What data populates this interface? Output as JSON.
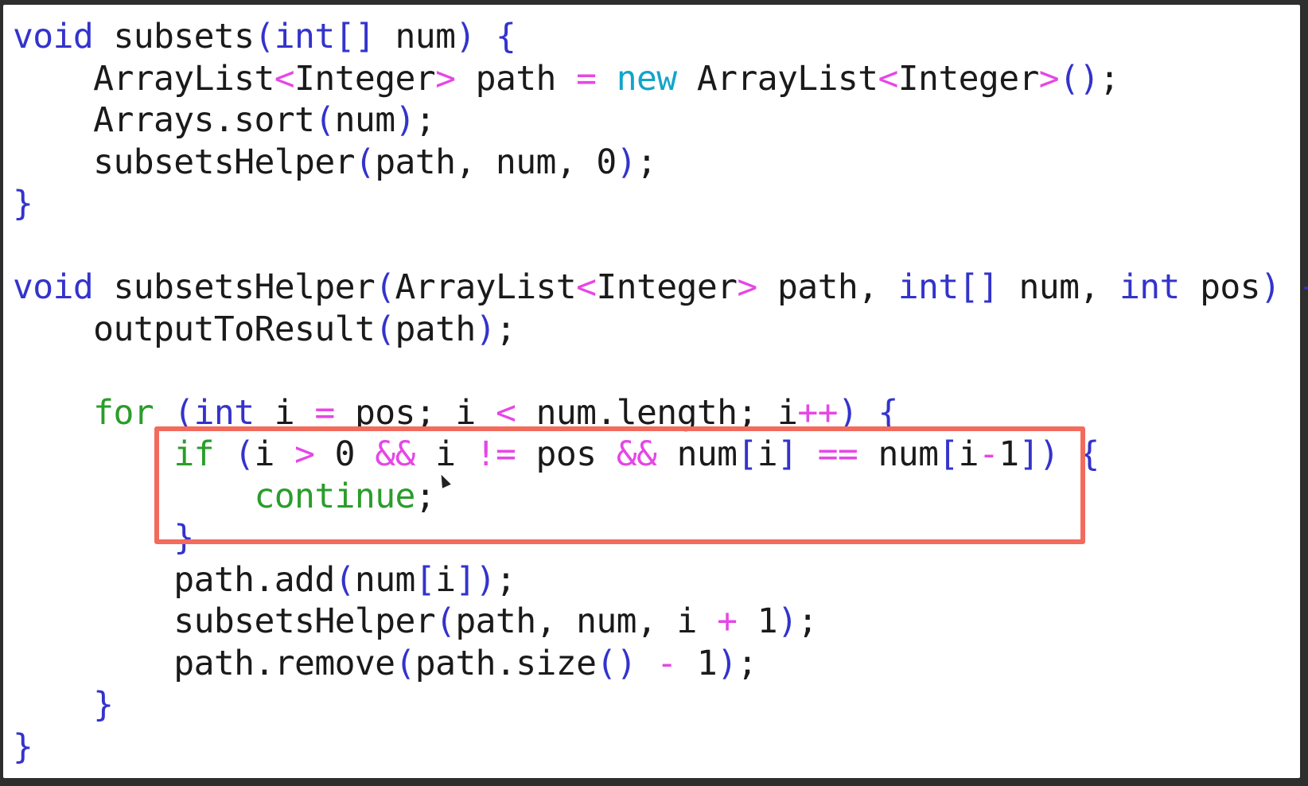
{
  "code": {
    "lines": [
      [
        {
          "t": "void",
          "c": "kw-blue"
        },
        {
          "t": " subsets",
          "c": ""
        },
        {
          "t": "(",
          "c": "br"
        },
        {
          "t": "int",
          "c": "kw-blue"
        },
        {
          "t": "[]",
          "c": "br"
        },
        {
          "t": " num",
          "c": ""
        },
        {
          "t": ")",
          "c": "br"
        },
        {
          "t": " {",
          "c": "br"
        }
      ],
      [
        {
          "t": "    ArrayList",
          "c": ""
        },
        {
          "t": "<",
          "c": "op"
        },
        {
          "t": "Integer",
          "c": ""
        },
        {
          "t": ">",
          "c": "op"
        },
        {
          "t": " path ",
          "c": ""
        },
        {
          "t": "=",
          "c": "op"
        },
        {
          "t": " ",
          "c": ""
        },
        {
          "t": "new",
          "c": "kw-cyan"
        },
        {
          "t": " ArrayList",
          "c": ""
        },
        {
          "t": "<",
          "c": "op"
        },
        {
          "t": "Integer",
          "c": ""
        },
        {
          "t": ">",
          "c": "op"
        },
        {
          "t": "()",
          "c": "br"
        },
        {
          "t": ";",
          "c": ""
        }
      ],
      [
        {
          "t": "    Arrays.sort",
          "c": ""
        },
        {
          "t": "(",
          "c": "br"
        },
        {
          "t": "num",
          "c": ""
        },
        {
          "t": ")",
          "c": "br"
        },
        {
          "t": ";",
          "c": ""
        }
      ],
      [
        {
          "t": "    subsetsHelper",
          "c": ""
        },
        {
          "t": "(",
          "c": "br"
        },
        {
          "t": "path, num, 0",
          "c": ""
        },
        {
          "t": ")",
          "c": "br"
        },
        {
          "t": ";",
          "c": ""
        }
      ],
      [
        {
          "t": "}",
          "c": "br"
        }
      ],
      [
        {
          "t": "",
          "c": ""
        }
      ],
      [
        {
          "t": "void",
          "c": "kw-blue"
        },
        {
          "t": " subsetsHelper",
          "c": ""
        },
        {
          "t": "(",
          "c": "br"
        },
        {
          "t": "ArrayList",
          "c": ""
        },
        {
          "t": "<",
          "c": "op"
        },
        {
          "t": "Integer",
          "c": ""
        },
        {
          "t": ">",
          "c": "op"
        },
        {
          "t": " path, ",
          "c": ""
        },
        {
          "t": "int",
          "c": "kw-blue"
        },
        {
          "t": "[]",
          "c": "br"
        },
        {
          "t": " num, ",
          "c": ""
        },
        {
          "t": "int",
          "c": "kw-blue"
        },
        {
          "t": " pos",
          "c": ""
        },
        {
          "t": ")",
          "c": "br"
        },
        {
          "t": " {",
          "c": "br"
        }
      ],
      [
        {
          "t": "    outputToResult",
          "c": ""
        },
        {
          "t": "(",
          "c": "br"
        },
        {
          "t": "path",
          "c": ""
        },
        {
          "t": ")",
          "c": "br"
        },
        {
          "t": ";",
          "c": ""
        }
      ],
      [
        {
          "t": "",
          "c": ""
        }
      ],
      [
        {
          "t": "    ",
          "c": ""
        },
        {
          "t": "for",
          "c": "kw-green"
        },
        {
          "t": " ",
          "c": ""
        },
        {
          "t": "(",
          "c": "br"
        },
        {
          "t": "int",
          "c": "kw-blue"
        },
        {
          "t": " i ",
          "c": ""
        },
        {
          "t": "=",
          "c": "op"
        },
        {
          "t": " pos; i ",
          "c": ""
        },
        {
          "t": "<",
          "c": "op"
        },
        {
          "t": " num.length; i",
          "c": ""
        },
        {
          "t": "++",
          "c": "op"
        },
        {
          "t": ")",
          "c": "br"
        },
        {
          "t": " {",
          "c": "br"
        }
      ],
      [
        {
          "t": "        ",
          "c": ""
        },
        {
          "t": "if",
          "c": "kw-green"
        },
        {
          "t": " ",
          "c": ""
        },
        {
          "t": "(",
          "c": "br"
        },
        {
          "t": "i ",
          "c": ""
        },
        {
          "t": ">",
          "c": "op"
        },
        {
          "t": " 0 ",
          "c": ""
        },
        {
          "t": "&&",
          "c": "op"
        },
        {
          "t": " i ",
          "c": ""
        },
        {
          "t": "!=",
          "c": "op"
        },
        {
          "t": " pos ",
          "c": ""
        },
        {
          "t": "&&",
          "c": "op"
        },
        {
          "t": " num",
          "c": ""
        },
        {
          "t": "[",
          "c": "br"
        },
        {
          "t": "i",
          "c": ""
        },
        {
          "t": "]",
          "c": "br"
        },
        {
          "t": " ",
          "c": ""
        },
        {
          "t": "==",
          "c": "op"
        },
        {
          "t": " num",
          "c": ""
        },
        {
          "t": "[",
          "c": "br"
        },
        {
          "t": "i",
          "c": ""
        },
        {
          "t": "-",
          "c": "op"
        },
        {
          "t": "1",
          "c": ""
        },
        {
          "t": "])",
          "c": "br"
        },
        {
          "t": " {",
          "c": "br"
        }
      ],
      [
        {
          "t": "            ",
          "c": ""
        },
        {
          "t": "continue",
          "c": "kw-green"
        },
        {
          "t": ";",
          "c": ""
        }
      ],
      [
        {
          "t": "        ",
          "c": ""
        },
        {
          "t": "}",
          "c": "br"
        }
      ],
      [
        {
          "t": "        path.add",
          "c": ""
        },
        {
          "t": "(",
          "c": "br"
        },
        {
          "t": "num",
          "c": ""
        },
        {
          "t": "[",
          "c": "br"
        },
        {
          "t": "i",
          "c": ""
        },
        {
          "t": "])",
          "c": "br"
        },
        {
          "t": ";",
          "c": ""
        }
      ],
      [
        {
          "t": "        subsetsHelper",
          "c": ""
        },
        {
          "t": "(",
          "c": "br"
        },
        {
          "t": "path, num, i ",
          "c": ""
        },
        {
          "t": "+",
          "c": "op"
        },
        {
          "t": " 1",
          "c": ""
        },
        {
          "t": ")",
          "c": "br"
        },
        {
          "t": ";",
          "c": ""
        }
      ],
      [
        {
          "t": "        path.remove",
          "c": ""
        },
        {
          "t": "(",
          "c": "br"
        },
        {
          "t": "path.size",
          "c": ""
        },
        {
          "t": "()",
          "c": "br"
        },
        {
          "t": " ",
          "c": ""
        },
        {
          "t": "-",
          "c": "op"
        },
        {
          "t": " 1",
          "c": ""
        },
        {
          "t": ")",
          "c": "br"
        },
        {
          "t": ";",
          "c": ""
        }
      ],
      [
        {
          "t": "    ",
          "c": ""
        },
        {
          "t": "}",
          "c": "br"
        }
      ],
      [
        {
          "t": "}",
          "c": "br"
        }
      ]
    ]
  },
  "colors": {
    "keyword_type": "#3333cc",
    "keyword_new": "#13a4c9",
    "keyword_control": "#2a9d2a",
    "operator": "#e646e6",
    "highlight_box": "#f26b5c",
    "background": "#ffffff"
  },
  "icons": {
    "cursor": "mouse-pointer-icon"
  }
}
